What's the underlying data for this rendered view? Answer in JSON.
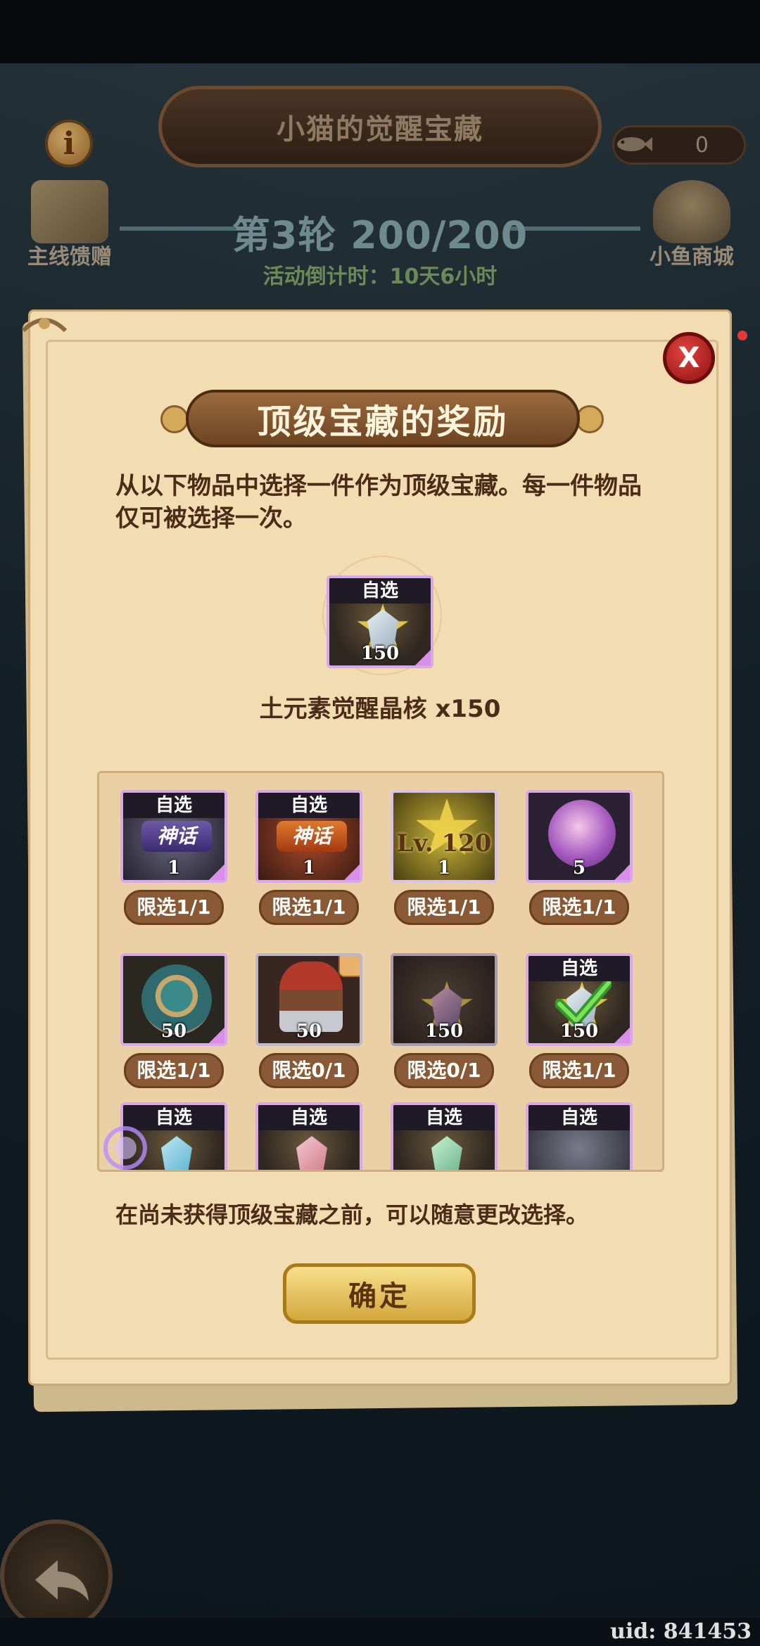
{
  "header": {
    "title": "小猫的觉醒宝藏",
    "info_icon": "i",
    "currency_value": "0",
    "left_icon_label": "主线馈赠",
    "right_icon_label": "小鱼商城",
    "round": "第3轮 200/200",
    "countdown": "活动倒计时：10天6小时"
  },
  "panel": {
    "close_label": "X",
    "title": "顶级宝藏的奖励",
    "description": "从以下物品中选择一件作为顶级宝藏。每一件物品仅可被选择一次。",
    "selected": {
      "tag": "自选",
      "count": "150",
      "name": "土元素觉醒晶核 x150"
    },
    "grid": [
      {
        "tag": "自选",
        "badge": "神话",
        "count": "1",
        "limit": "限选1/1"
      },
      {
        "tag": "自选",
        "badge": "神话",
        "count": "1",
        "limit": "限选1/1"
      },
      {
        "badge": "Lv. 120",
        "count": "1",
        "limit": "限选1/1"
      },
      {
        "count": "5",
        "limit": "限选1/1"
      },
      {
        "count": "50",
        "limit": "限选1/1"
      },
      {
        "count": "50",
        "limit": "限选0/1"
      },
      {
        "count": "150",
        "limit": "限选0/1"
      },
      {
        "tag": "自选",
        "count": "150",
        "limit": "限选1/1"
      },
      {
        "tag": "自选"
      },
      {
        "tag": "自选"
      },
      {
        "tag": "自选"
      },
      {
        "tag": "自选"
      }
    ],
    "note": "在尚未获得顶级宝藏之前，可以随意更改选择。",
    "confirm_label": "确定"
  },
  "footer": {
    "uid": "uid: 841453"
  },
  "colors": {
    "parchment": "#f2dcb2",
    "banner": "#7d5030",
    "confirm": "#e6c060",
    "close": "#c42522"
  }
}
